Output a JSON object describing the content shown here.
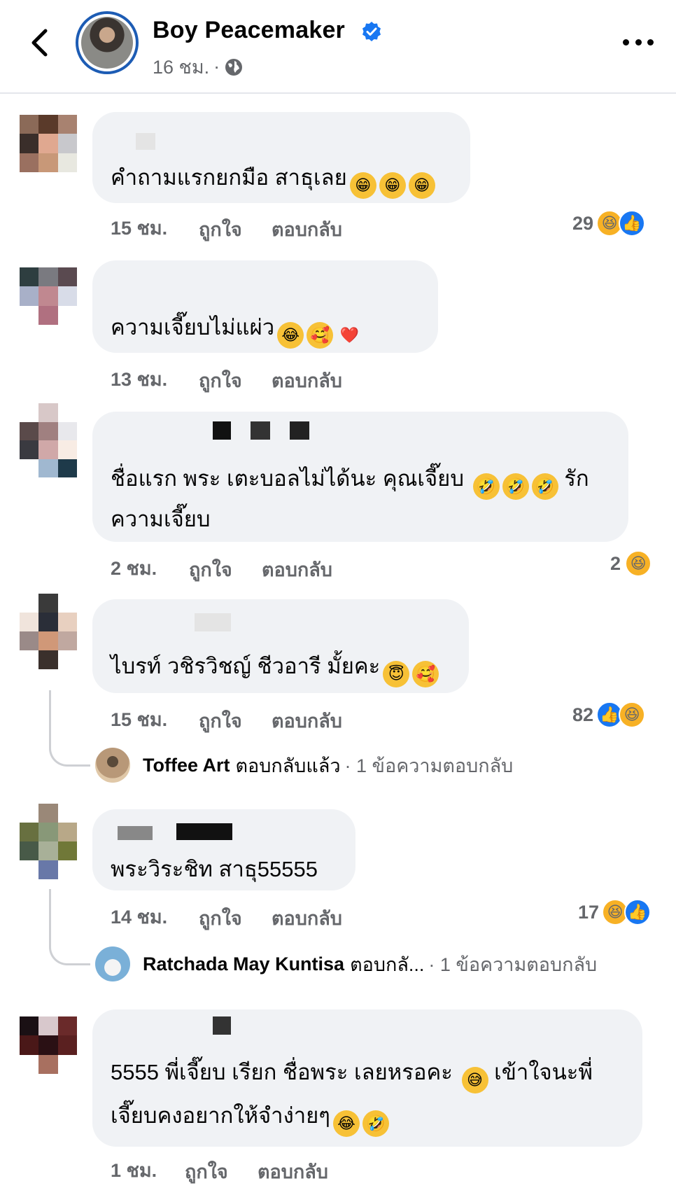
{
  "header": {
    "page_name": "Boy Peacemaker",
    "time": "16 ชม.",
    "dot": "·",
    "icons": {
      "back": "chevron-left-icon",
      "verified": "verified-badge-icon",
      "globe": "globe-icon",
      "more": "more-icon"
    }
  },
  "actions": {
    "like": "ถูกใจ",
    "reply": "ตอบกลับ"
  },
  "comments": [
    {
      "text": "คำถามแรกยกมือ สาธุเลย",
      "emojis": [
        "😁",
        "😁",
        "😁"
      ],
      "time": "15 ชม.",
      "reaction_count": "29",
      "reactions": [
        "haha",
        "like"
      ]
    },
    {
      "text": "ความเจี๊ยบไม่แผ่ว",
      "emojis": [
        "😂",
        "🥰",
        "❤️"
      ],
      "time": "13 ชม."
    },
    {
      "text_line1": "ชื่อแรก พระ เตะบอลไม่ได้นะ คุณเจี๊ยบ",
      "emojis": [
        "🤣",
        "🤣",
        "🤣"
      ],
      "text_line1_end": "รัก",
      "text_line2": "ความเจี๊ยบ",
      "time": "2 ชม.",
      "reaction_count": "2",
      "reactions": [
        "haha"
      ]
    },
    {
      "text": "ไบรท์ วชิรวิชญ์ ชีวอารี มั้ยคะ",
      "emojis": [
        "😇",
        "🥰"
      ],
      "time": "15 ชม.",
      "reaction_count": "82",
      "reactions": [
        "like",
        "haha"
      ],
      "reply": {
        "name": "Toffee Art",
        "verb": "ตอบกลับแล้ว",
        "count": "· 1 ข้อความตอบกลับ"
      }
    },
    {
      "text": "พระวิระชิท สาธุ55555",
      "time": "14 ชม.",
      "reaction_count": "17",
      "reactions": [
        "haha",
        "like"
      ],
      "reply": {
        "name": "Ratchada May Kuntisa",
        "verb": "ตอบกลั...",
        "count": "· 1 ข้อความตอบกลับ"
      }
    },
    {
      "text_line1": "5555 พี่เจี๊ยบ เรียก ชื่อพระ เลยหรอคะ",
      "emoji_mid": "😅",
      "text_line1_end": "เข้าใจนะพี่",
      "text_line2": "เจี๊ยบคงอยากให้จำง่ายๆ",
      "emojis2": [
        "😂",
        "🤣"
      ],
      "time": "1 ชม."
    }
  ],
  "colors": {
    "accent": "#1877f2",
    "bubble": "#f0f2f5",
    "muted": "#65676b",
    "ring": "#1d5cb4"
  }
}
